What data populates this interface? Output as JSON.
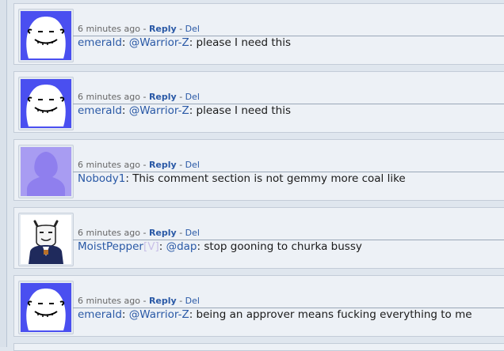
{
  "comments": [
    {
      "time": "6 minutes ago",
      "sep1": " - ",
      "reply": "Reply",
      "sep2": " - ",
      "del": "Del",
      "username": "emerald",
      "colon1": ": ",
      "mention": "@Warrior-Z",
      "colon2": ": ",
      "text": "please I need this",
      "avatar": "blob-face-icon"
    },
    {
      "time": "6 minutes ago",
      "sep1": " - ",
      "reply": "Reply",
      "sep2": " - ",
      "del": "Del",
      "username": "emerald",
      "colon1": ": ",
      "mention": "@Warrior-Z",
      "colon2": ": ",
      "text": "please I need this",
      "avatar": "blob-face-icon"
    },
    {
      "time": "6 minutes ago",
      "sep1": " - ",
      "reply": "Reply",
      "sep2": " - ",
      "del": "Del",
      "username": "Nobody1",
      "colon1": ": ",
      "text": "This comment section is not gemmy more coal like",
      "avatar": "default-silhouette-icon"
    },
    {
      "time": "6 minutes ago",
      "sep1": " - ",
      "reply": "Reply",
      "sep2": " - ",
      "del": "Del",
      "username": "MoistPepper",
      "flair": "[V]",
      "colon1": ": ",
      "mention": "@dap",
      "colon2": ": ",
      "text": "stop gooning to churka bussy",
      "avatar": "cartoon-goat-icon"
    },
    {
      "time": "6 minutes ago",
      "sep1": " - ",
      "reply": "Reply",
      "sep2": " - ",
      "del": "Del",
      "username": "emerald",
      "colon1": ": ",
      "mention": "@Warrior-Z",
      "colon2": ": ",
      "text": "being an approver means fucking everything to me",
      "avatar": "blob-face-icon"
    }
  ],
  "colors": {
    "link": "#2a59a6",
    "avatar_blue": "#4a4ff0",
    "avatar_purple": "#a89cf2"
  }
}
